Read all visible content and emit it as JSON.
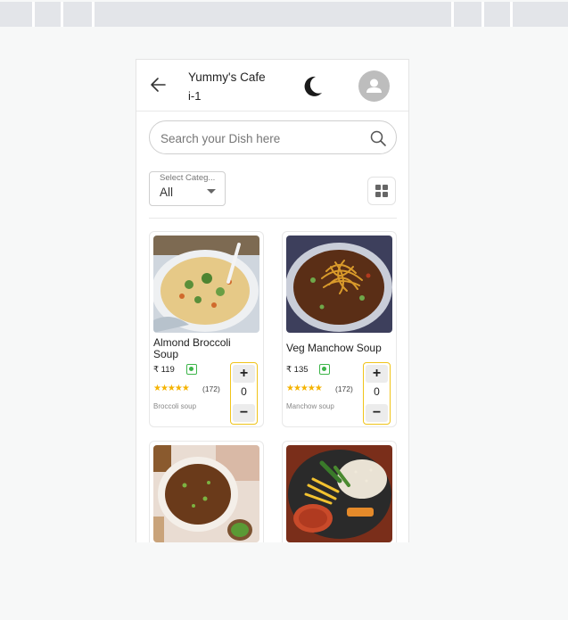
{
  "header": {
    "cafe_name": "Yummy's Cafe",
    "table_no": "i-1"
  },
  "search": {
    "placeholder": "Search your Dish here",
    "value": ""
  },
  "category": {
    "label": "Select Categ...",
    "value": "All"
  },
  "colors": {
    "accent": "#f0c419",
    "veg": "#3db54a",
    "star": "#f5b301"
  },
  "icons": [
    "arrow-left-icon",
    "moon-icon",
    "user-icon",
    "search-icon",
    "chevron-down-icon",
    "grid-view-icon",
    "veg-mark-icon",
    "star-icon",
    "plus-icon",
    "minus-icon"
  ],
  "dishes": [
    {
      "name": "Almond Broccoli Soup",
      "price": "₹ 119",
      "rating_stars": "★★★★★",
      "rating": 5,
      "reviews": "(172)",
      "description": "Broccoli soup",
      "qty": "0",
      "plus": "+",
      "minus": "−"
    },
    {
      "name": "Veg Manchow Soup",
      "price": "₹ 135",
      "rating_stars": "★★★★★",
      "rating": 5,
      "reviews": "(172)",
      "description": "Manchow soup",
      "qty": "0",
      "plus": "+",
      "minus": "−"
    },
    {
      "name": "",
      "price": "",
      "reviews": "",
      "description": ""
    },
    {
      "name": "",
      "price": "",
      "reviews": "",
      "description": ""
    }
  ]
}
